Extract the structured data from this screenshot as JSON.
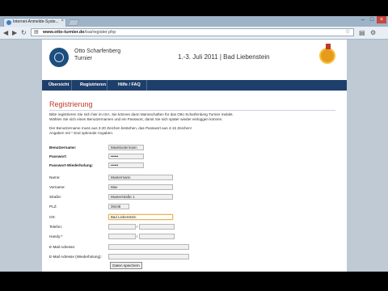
{
  "browser": {
    "tab_title": "Internet-Anmelde-Syste...",
    "tab_close": "×",
    "url_domain": "www.otto-turnier.de",
    "url_path": "/isa/register.php",
    "back": "◀",
    "forward": "▶",
    "reload": "↻",
    "star": "☆",
    "page_icon": "▤",
    "wrench": "⚙",
    "win_min": "–",
    "win_max": "□",
    "win_close": "×"
  },
  "header": {
    "name_line1": "Otto Scharfenberg",
    "name_line2": "Turnier",
    "date_location": "1.-3. Juli 2011 | Bad Liebenstein"
  },
  "nav": {
    "items": [
      {
        "label": "Übersicht"
      },
      {
        "label": "Registrieren"
      },
      {
        "label": "Hilfe / FAQ"
      }
    ]
  },
  "page": {
    "title": "Registrierung",
    "intro_line1": "Bitte registrieren Sie sich hier im ISA. Sie können dann Mannschaften für das Otto Scharfenberg Turnier meldet.",
    "intro_line2": "Wählen Sie sich einen Benutzernamen und ein Passwort, damit Sie sich später wieder einloggen können.",
    "rules_line1": "Der Benutzername muss aus 3-20 Zeichen bestehen, das Passwort aus 4-15 Zeichen!",
    "rules_line2": "Angaben mit * sind optionale Angaben."
  },
  "form": {
    "username_label": "Benutzername:",
    "username_value": "MaxMustermann",
    "password_label": "Passwort:",
    "password_value": "••••••",
    "password_repeat_label": "Passwort-Wiederholung:",
    "password_repeat_value": "••••••",
    "lastname_label": "Name:",
    "lastname_value": "Mustermann",
    "firstname_label": "Vorname:",
    "firstname_value": "Max",
    "street_label": "Straße:",
    "street_value": "Musterstraße 1",
    "zip_label": "PLZ:",
    "zip_value": "36448",
    "city_label": "Ort:",
    "city_value": "Bad Liebenstein",
    "phone_label": "Telefon:",
    "phone_prefix_value": "",
    "phone_number_value": "",
    "phone_sep": "/",
    "mobile_label": "Handy:*",
    "mobile_prefix_value": "",
    "mobile_number_value": "",
    "mobile_sep": "/",
    "email_label": "E-Mail Adresse:",
    "email_value": "",
    "email_repeat_label": "E-Mail Adresse (Wiederholung):",
    "email_repeat_value": "",
    "submit_label": "Daten speichern"
  }
}
